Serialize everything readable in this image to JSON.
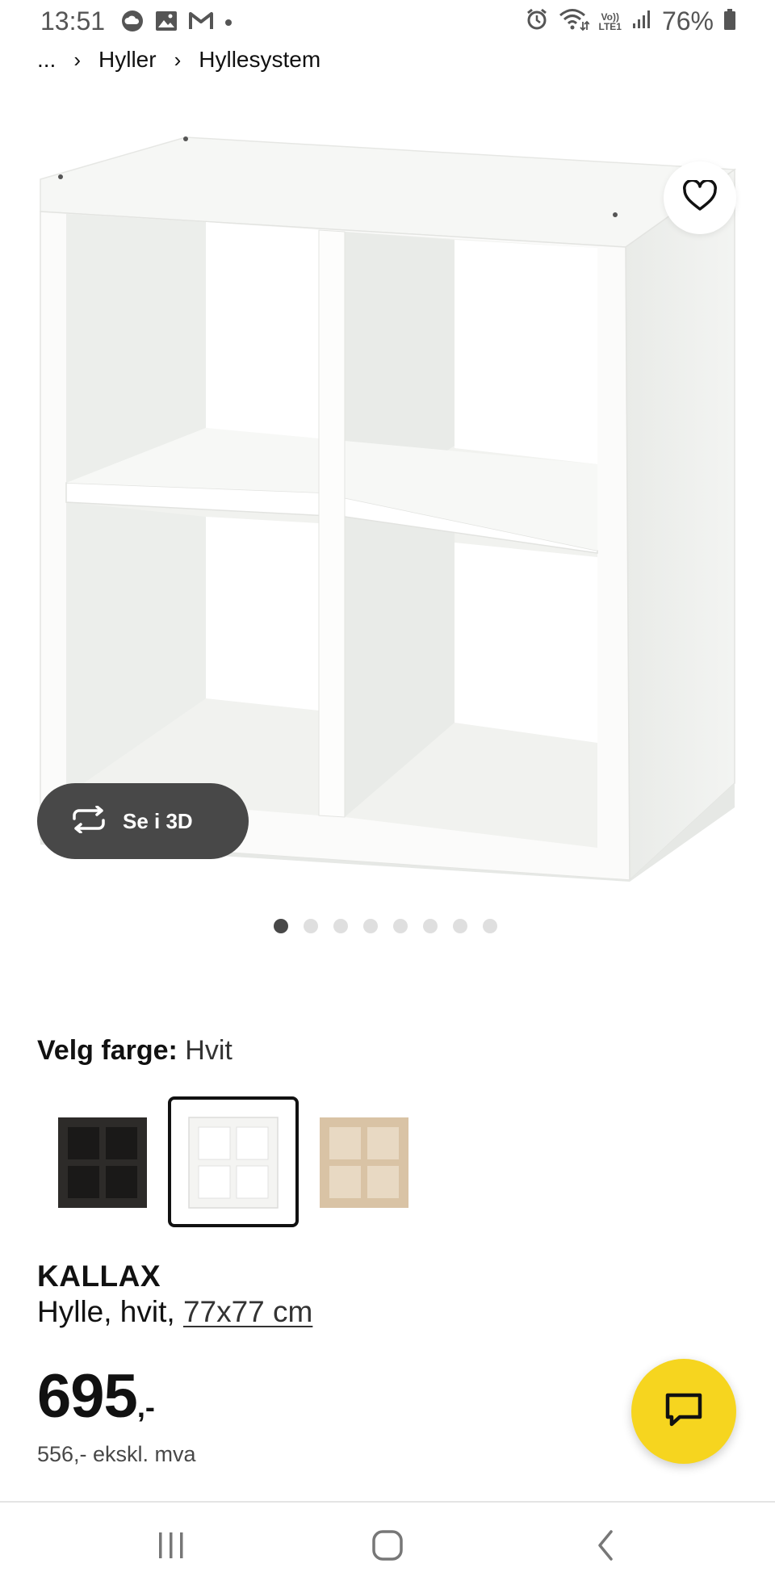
{
  "status_bar": {
    "time": "13:51",
    "left_icons": [
      "cloud-icon",
      "image-icon",
      "gmail-icon",
      "dot-icon"
    ],
    "right_icons": [
      "alarm-icon",
      "wifi-icon",
      "volte-icon",
      "signal-icon",
      "battery-icon"
    ],
    "volte_label_top": "Vo))",
    "volte_label_bottom": "LTE1",
    "battery": "76%"
  },
  "breadcrumb": {
    "items": [
      "...",
      "Hyller",
      "Hyllesystem"
    ]
  },
  "gallery": {
    "see_3d_label": "Se i 3D",
    "dot_count": 8,
    "active_index": 0
  },
  "color": {
    "label": "Velg farge:",
    "value": "Hvit",
    "options": [
      {
        "name": "black-brown",
        "color": "#2d2b29"
      },
      {
        "name": "white",
        "color": "#f4f4f2",
        "selected": true
      },
      {
        "name": "white-stained-oak",
        "color": "#d9c3a5"
      }
    ]
  },
  "product": {
    "name": "KALLAX",
    "description_prefix": "Hylle, hvit, ",
    "dimension_link": "77x77 cm",
    "price": "695",
    "price_suffix": ",-",
    "price_ex_vat": "556,- ekskl. mva"
  },
  "colors": {
    "accent_yellow": "#f6d51f",
    "dark_button": "#484848"
  }
}
